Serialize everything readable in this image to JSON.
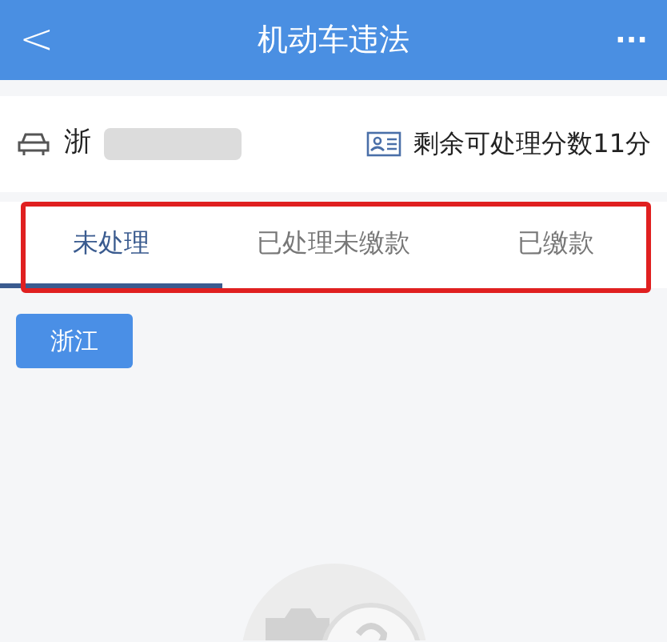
{
  "header": {
    "back_icon": "<",
    "title": "机动车违法",
    "more_icon": "···"
  },
  "vehicle": {
    "plate": "浙",
    "plate_masked": true,
    "points": "剩余可处理分数11分"
  },
  "tabs": [
    {
      "label": "未处理",
      "selected": true
    },
    {
      "label": "已处理未缴款",
      "selected": false
    },
    {
      "label": "已缴款",
      "selected": false
    }
  ],
  "province_button": "浙江"
}
